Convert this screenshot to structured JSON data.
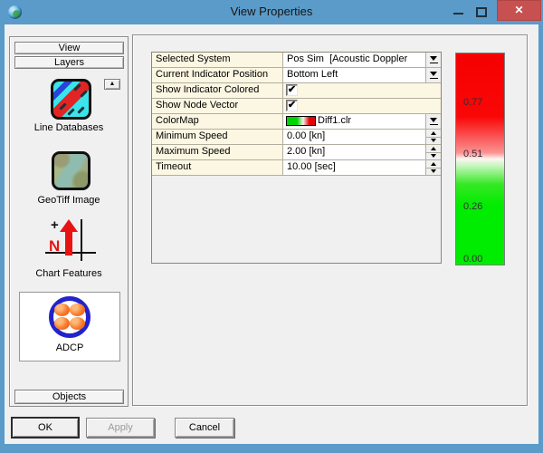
{
  "window": {
    "title": "View Properties",
    "controls": {
      "close_glyph": "✕"
    }
  },
  "sidebar": {
    "view_label": "View",
    "layers_label": "Layers",
    "objects_label": "Objects",
    "scroll_up_glyph": "▲",
    "layers": [
      {
        "label": "Line Databases",
        "selected": false
      },
      {
        "label": "GeoTiff Image",
        "selected": false
      },
      {
        "label": "Chart Features",
        "selected": false
      },
      {
        "label": "ADCP",
        "selected": true
      }
    ]
  },
  "properties": {
    "check_glyph": "✔",
    "rows": [
      {
        "label": "Selected System",
        "type": "dropdown",
        "value": "Pos Sim  [Acoustic Doppler"
      },
      {
        "label": "Current Indicator Position",
        "type": "dropdown",
        "value": "Bottom Left"
      },
      {
        "label": "Show Indicator Colored",
        "type": "checkbox",
        "checked": true
      },
      {
        "label": "Show Node Vector",
        "type": "checkbox",
        "checked": true
      },
      {
        "label": "ColorMap",
        "type": "colormap-dropdown",
        "value": "Diff1.clr"
      },
      {
        "label": "Minimum Speed",
        "type": "spinner",
        "value": "0.00 [kn]"
      },
      {
        "label": "Maximum Speed",
        "type": "spinner",
        "value": "2.00 [kn]"
      },
      {
        "label": "Timeout",
        "type": "spinner",
        "value": "10.00 [sec]"
      }
    ]
  },
  "color_scale": {
    "labels": [
      "0.77",
      "0.51",
      "0.26",
      "0.00"
    ],
    "top_color": "#ff0000",
    "mid_color": "#ffffff",
    "bottom_color": "#00ec00"
  },
  "footer": {
    "ok_label": "OK",
    "apply_label": "Apply",
    "cancel_label": "Cancel",
    "apply_enabled": false
  },
  "colors": {
    "titlebar": "#5a9bc9",
    "close_button": "#c75050",
    "dialog_bg": "#f0f0f0",
    "grid_label_bg": "#fbf7e2"
  }
}
